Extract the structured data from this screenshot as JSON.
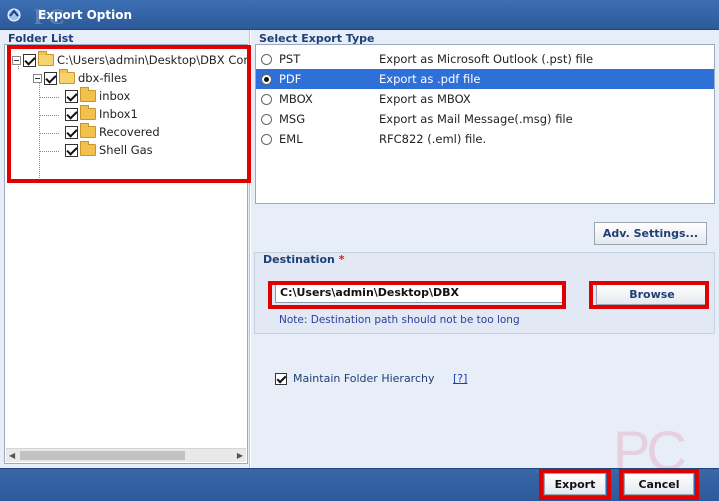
{
  "window": {
    "title": "Export Option",
    "watermark": "PC"
  },
  "folder_list": {
    "header": "Folder List",
    "root": {
      "label": "C:\\Users\\admin\\Desktop\\DBX Con",
      "checked": true
    },
    "child": {
      "label": "dbx-files",
      "checked": true
    },
    "folders": [
      {
        "label": "inbox",
        "checked": true
      },
      {
        "label": "Inbox1",
        "checked": true
      },
      {
        "label": "Recovered",
        "checked": true
      },
      {
        "label": "Shell Gas",
        "checked": true
      }
    ]
  },
  "export_type": {
    "header": "Select Export Type",
    "selected": "PDF",
    "options": [
      {
        "code": "PST",
        "desc": "Export as Microsoft Outlook (.pst) file"
      },
      {
        "code": "PDF",
        "desc": "Export as .pdf file"
      },
      {
        "code": "MBOX",
        "desc": "Export as MBOX"
      },
      {
        "code": "MSG",
        "desc": "Export as Mail Message(.msg) file"
      },
      {
        "code": "EML",
        "desc": "RFC822 (.eml) file."
      }
    ]
  },
  "adv_settings_label": "Adv. Settings...",
  "destination": {
    "title": "Destination",
    "required_mark": "*",
    "value": "C:\\Users\\admin\\Desktop\\DBX",
    "browse_label": "Browse",
    "note": "Note: Destination path should not be too long"
  },
  "hierarchy": {
    "label": "Maintain Folder Hierarchy",
    "checked": true,
    "help": "[?]"
  },
  "footer": {
    "export_label": "Export",
    "cancel_label": "Cancel"
  },
  "colors": {
    "highlight": "#e00000",
    "selection": "#2f6fd8",
    "title_bar": "#2c5a9a"
  }
}
